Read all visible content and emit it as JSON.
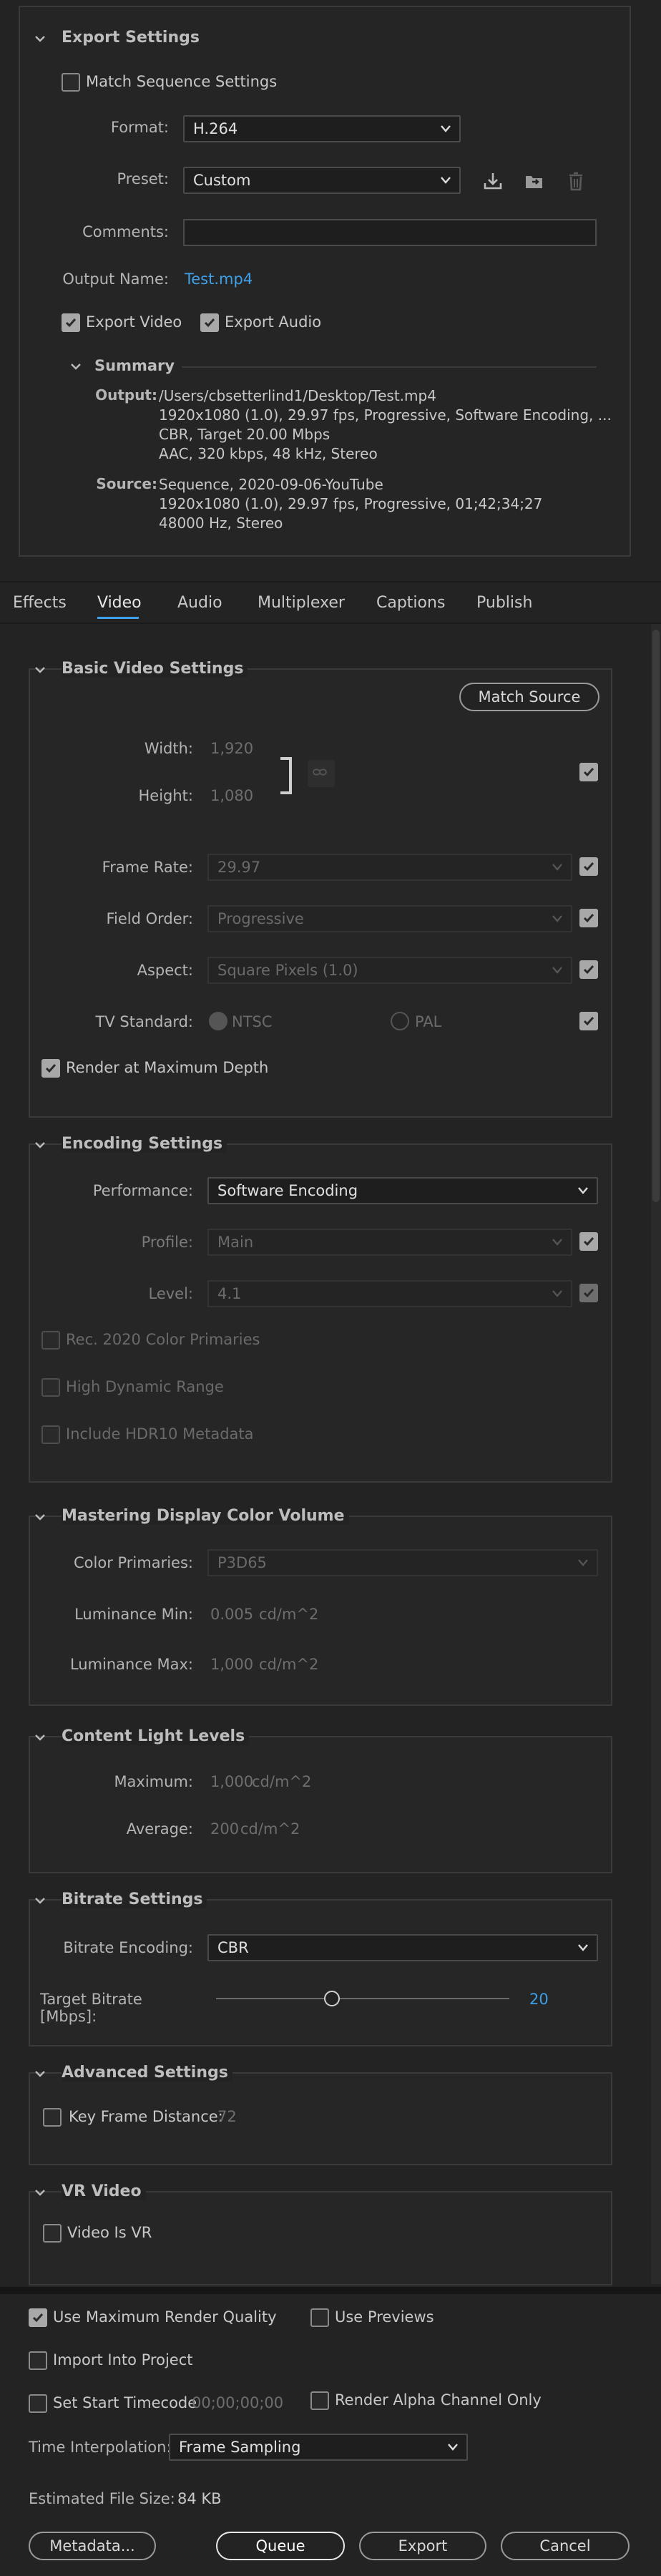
{
  "export_settings": {
    "title": "Export Settings",
    "match_sequence_label": "Match Sequence Settings",
    "match_sequence_checked": false,
    "format_label": "Format:",
    "format_value": "H.264",
    "preset_label": "Preset:",
    "preset_value": "Custom",
    "comments_label": "Comments:",
    "comments_value": "",
    "output_name_label": "Output Name:",
    "output_name_value": "Test.mp4",
    "export_video_label": "Export Video",
    "export_audio_label": "Export Audio",
    "summary": {
      "title": "Summary",
      "output_label": "Output:",
      "output_lines": [
        "/Users/cbsetterlind1/Desktop/Test.mp4",
        "1920x1080 (1.0), 29.97 fps, Progressive, Software Encoding, ...",
        "CBR, Target 20.00 Mbps",
        "AAC, 320 kbps, 48 kHz, Stereo"
      ],
      "source_label": "Source:",
      "source_lines": [
        "Sequence, 2020-09-06-YouTube",
        "1920x1080 (1.0), 29.97 fps, Progressive, 01;42;34;27",
        "48000 Hz, Stereo"
      ]
    }
  },
  "tabs": [
    "Effects",
    "Video",
    "Audio",
    "Multiplexer",
    "Captions",
    "Publish"
  ],
  "active_tab": "Video",
  "basic_video": {
    "title": "Basic Video Settings",
    "match_source_label": "Match Source",
    "width_label": "Width:",
    "width_value": "1,920",
    "height_label": "Height:",
    "height_value": "1,080",
    "frame_rate_label": "Frame Rate:",
    "frame_rate_value": "29.97",
    "field_order_label": "Field Order:",
    "field_order_value": "Progressive",
    "aspect_label": "Aspect:",
    "aspect_value": "Square Pixels (1.0)",
    "tv_standard_label": "TV Standard:",
    "ntsc_label": "NTSC",
    "pal_label": "PAL",
    "render_max_depth_label": "Render at Maximum Depth"
  },
  "encoding": {
    "title": "Encoding Settings",
    "performance_label": "Performance:",
    "performance_value": "Software Encoding",
    "profile_label": "Profile:",
    "profile_value": "Main",
    "level_label": "Level:",
    "level_value": "4.1",
    "rec2020_label": "Rec. 2020 Color Primaries",
    "hdr_label": "High Dynamic Range",
    "hdr10_label": "Include HDR10 Metadata"
  },
  "mastering": {
    "title": "Mastering Display Color Volume",
    "color_primaries_label": "Color Primaries:",
    "color_primaries_value": "P3D65",
    "lum_min_label": "Luminance Min:",
    "lum_min_value": "0.005",
    "lum_min_unit": "cd/m^2",
    "lum_max_label": "Luminance Max:",
    "lum_max_value": "1,000",
    "lum_max_unit": "cd/m^2"
  },
  "content_light": {
    "title": "Content Light Levels",
    "maximum_label": "Maximum:",
    "maximum_value": "1,000",
    "maximum_unit": "cd/m^2",
    "average_label": "Average:",
    "average_value": "200",
    "average_unit": "cd/m^2"
  },
  "bitrate": {
    "title": "Bitrate Settings",
    "encoding_label": "Bitrate Encoding:",
    "encoding_value": "CBR",
    "target_label": "Target Bitrate [Mbps]:",
    "target_value": "20",
    "target_fraction": 0.39
  },
  "advanced": {
    "title": "Advanced Settings",
    "key_frame_label": "Key Frame Distance:",
    "key_frame_value": "72"
  },
  "vr": {
    "title": "VR Video",
    "video_is_vr_label": "Video Is VR"
  },
  "footer": {
    "max_render_quality_label": "Use Maximum Render Quality",
    "use_previews_label": "Use Previews",
    "import_project_label": "Import Into Project",
    "render_alpha_label": "Render Alpha Channel Only",
    "set_start_timecode_label": "Set Start Timecode",
    "start_timecode_value": "00;00;00;00",
    "time_interp_label": "Time Interpolation:",
    "time_interp_value": "Frame Sampling",
    "file_size_label": "Estimated File Size:",
    "file_size_value": "84 KB",
    "metadata_label": "Metadata...",
    "queue_label": "Queue",
    "export_label": "Export",
    "cancel_label": "Cancel"
  },
  "colors": {
    "accent": "#3ea0e8",
    "background": "#232323",
    "panel": "#262626"
  },
  "icons": [
    "chevron-down-icon",
    "save-preset-icon",
    "import-preset-icon",
    "trash-icon",
    "link-icon",
    "checkmark-icon"
  ]
}
